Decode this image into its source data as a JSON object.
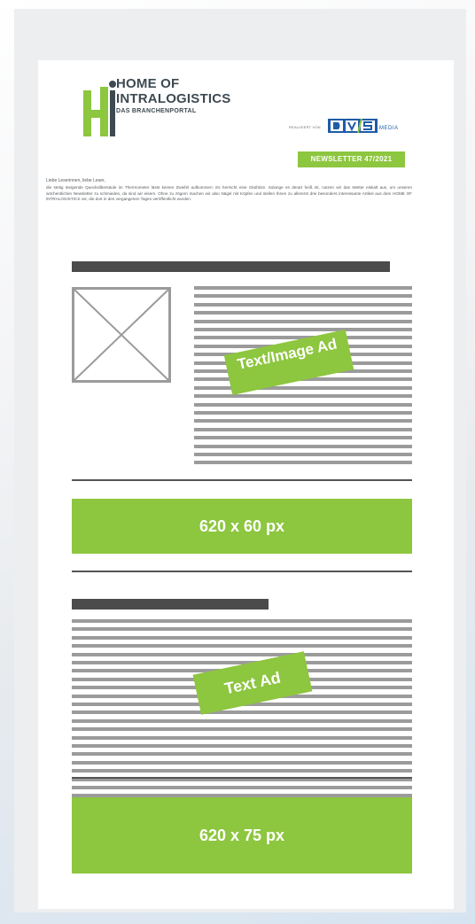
{
  "header": {
    "logo_line1": "HOME OF",
    "logo_line2": "INTRALOGISTICS",
    "logo_line3": "DAS BRANCHENPORTAL",
    "realised_by": "REALISIERT VON",
    "publisher_letters": "D V S",
    "publisher_suffix": "MEDIA",
    "newsletter_badge": "NEWSLETTER 47/2021"
  },
  "intro": {
    "greeting": "Liebe Leserinnen, liebe Leser,",
    "body": "die stetig steigende Quecksilbersäule im Thermometer lässt keinen Zweifel aufkommen: Es herrscht eine Gluthitze. Solange es derart heiß ist, nutzen wir das Wetter eiskalt aus, um unseren wöchentlichen Newsletter zu schmieden, da sind wir eisern. Ohne zu zögern machen wir also Nägel mit Köpfen und stellen Ihnen zu allererst drei besonders interessante Artikel aus dem HOME OF INTRALOGISTICS vor, die dort in den vergangenen Tagen veröffentlicht wurden."
  },
  "ads": {
    "text_image_ad": "Text/Image Ad",
    "banner_60": "620 x 60 px",
    "text_ad": "Text Ad",
    "banner_75": "620 x 75 px"
  },
  "colors": {
    "accent_green": "#8dc63f",
    "placeholder_gray": "#9b9b9b",
    "heading_dark": "#4b4b4b",
    "logo_blue": "#1e5ca8"
  }
}
